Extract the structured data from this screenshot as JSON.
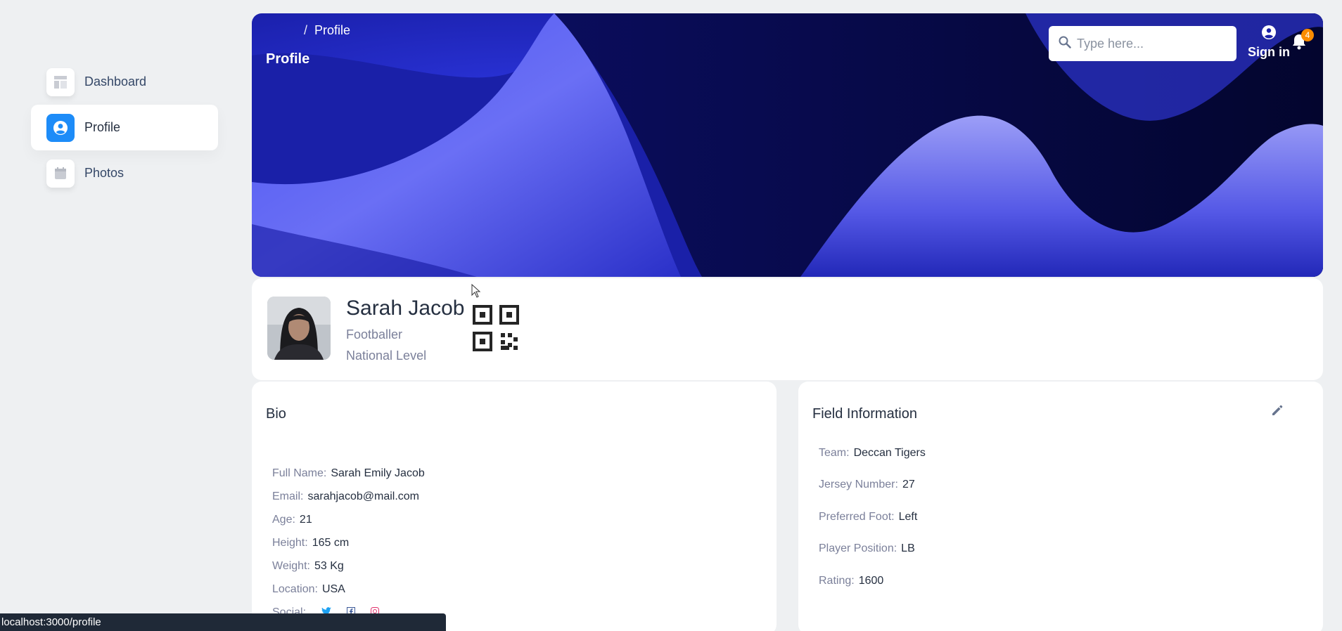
{
  "sidebar": {
    "items": [
      {
        "label": "Dashboard",
        "icon": "dashboard-icon"
      },
      {
        "label": "Profile",
        "icon": "user-circle-icon",
        "active": true
      },
      {
        "label": "Photos",
        "icon": "calendar-icon"
      }
    ]
  },
  "header": {
    "breadcrumb_sep": "/",
    "breadcrumb_current": "Profile",
    "title": "Profile",
    "search_placeholder": "Type here...",
    "signin_label": "Sign in",
    "notification_count": "4"
  },
  "profile": {
    "name": "Sarah Jacob",
    "role": "Footballer",
    "level": "National Level"
  },
  "bio": {
    "title": "Bio",
    "fields": [
      {
        "label": "Full Name",
        "value": "Sarah Emily Jacob"
      },
      {
        "label": "Email",
        "value": "sarahjacob@mail.com"
      },
      {
        "label": "Age",
        "value": "21"
      },
      {
        "label": "Height",
        "value": "165 cm"
      },
      {
        "label": "Weight",
        "value": "53 Kg"
      },
      {
        "label": "Location",
        "value": "USA"
      }
    ],
    "social_label": "Social"
  },
  "field_info": {
    "title": "Field Information",
    "fields": [
      {
        "label": "Team",
        "value": "Deccan Tigers"
      },
      {
        "label": "Jersey Number",
        "value": "27"
      },
      {
        "label": "Preferred Foot",
        "value": "Left"
      },
      {
        "label": "Player Position",
        "value": "LB"
      },
      {
        "label": "Rating",
        "value": "1600"
      }
    ]
  },
  "status_bar": {
    "url": "localhost:3000/profile"
  },
  "colors": {
    "accent": "#1d8cf8",
    "badge": "#fb8c00",
    "banner_dark": "#0b0f6e"
  }
}
